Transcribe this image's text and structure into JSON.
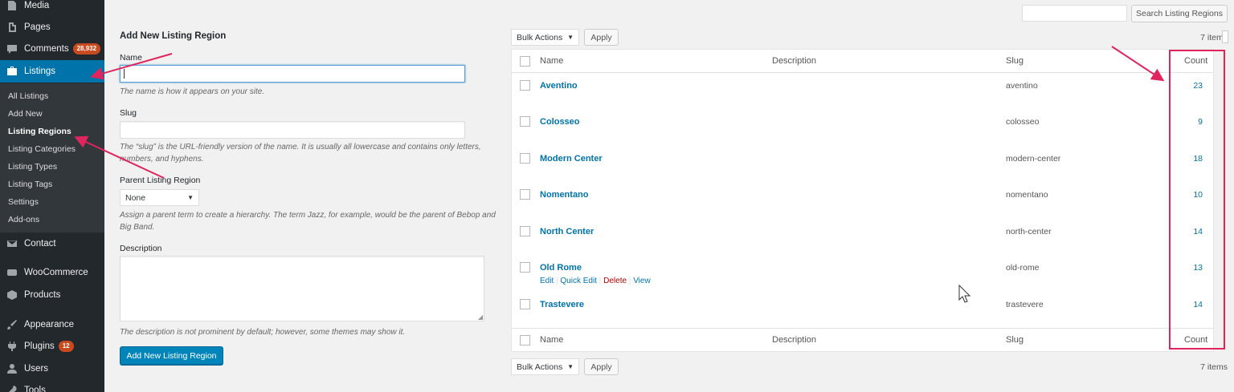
{
  "sidebar": {
    "items": [
      {
        "label": "Media",
        "icon": "media-icon"
      },
      {
        "label": "Pages",
        "icon": "pages-icon"
      },
      {
        "label": "Comments",
        "icon": "comments-icon",
        "badge": "28,932"
      },
      {
        "label": "Listings",
        "icon": "briefcase-icon",
        "active": true
      },
      {
        "label": "Contact",
        "icon": "envelope-icon"
      },
      {
        "label": "WooCommerce",
        "icon": "woocommerce-icon"
      },
      {
        "label": "Products",
        "icon": "products-icon"
      },
      {
        "label": "Appearance",
        "icon": "paintbrush-icon"
      },
      {
        "label": "Plugins",
        "icon": "plugin-icon",
        "badge": "12"
      },
      {
        "label": "Users",
        "icon": "users-icon"
      },
      {
        "label": "Tools",
        "icon": "tools-icon"
      }
    ],
    "submenu": [
      {
        "label": "All Listings"
      },
      {
        "label": "Add New"
      },
      {
        "label": "Listing Regions",
        "current": true
      },
      {
        "label": "Listing Categories"
      },
      {
        "label": "Listing Types"
      },
      {
        "label": "Listing Tags"
      },
      {
        "label": "Settings"
      },
      {
        "label": "Add-ons"
      }
    ]
  },
  "form": {
    "title": "Add New Listing Region",
    "name_label": "Name",
    "name_value": "",
    "name_hint": "The name is how it appears on your site.",
    "slug_label": "Slug",
    "slug_value": "",
    "slug_hint": "The “slug” is the URL-friendly version of the name. It is usually all lowercase and contains only letters, numbers, and hyphens.",
    "parent_label": "Parent Listing Region",
    "parent_value": "None",
    "parent_hint": "Assign a parent term to create a hierarchy. The term Jazz, for example, would be the parent of Bebop and Big Band.",
    "description_label": "Description",
    "description_value": "",
    "description_hint": "The description is not prominent by default; however, some themes may show it.",
    "submit_label": "Add New Listing Region"
  },
  "search": {
    "value": "",
    "button_label": "Search Listing Regions"
  },
  "table": {
    "bulk_actions": "Bulk Actions",
    "apply_label": "Apply",
    "items_count": "7 items",
    "columns": {
      "name": "Name",
      "description": "Description",
      "slug": "Slug",
      "count": "Count"
    },
    "rows": [
      {
        "name": "Aventino",
        "slug": "aventino",
        "count": "23"
      },
      {
        "name": "Colosseo",
        "slug": "colosseo",
        "count": "9"
      },
      {
        "name": "Modern Center",
        "slug": "modern-center",
        "count": "18"
      },
      {
        "name": "Nomentano",
        "slug": "nomentano",
        "count": "10"
      },
      {
        "name": "North Center",
        "slug": "north-center",
        "count": "14"
      },
      {
        "name": "Old Rome",
        "slug": "old-rome",
        "count": "13",
        "hover": true
      },
      {
        "name": "Trastevere",
        "slug": "trastevere",
        "count": "14"
      }
    ],
    "row_actions": {
      "edit": "Edit",
      "quick_edit": "Quick Edit",
      "delete": "Delete",
      "view": "View"
    }
  },
  "colors": {
    "sidebar_bg": "#23282d",
    "submenu_bg": "#32373c",
    "accent": "#0073aa",
    "primary_button": "#0085ba",
    "badge": "#ca4a1f",
    "annotation": "#e0245e"
  }
}
